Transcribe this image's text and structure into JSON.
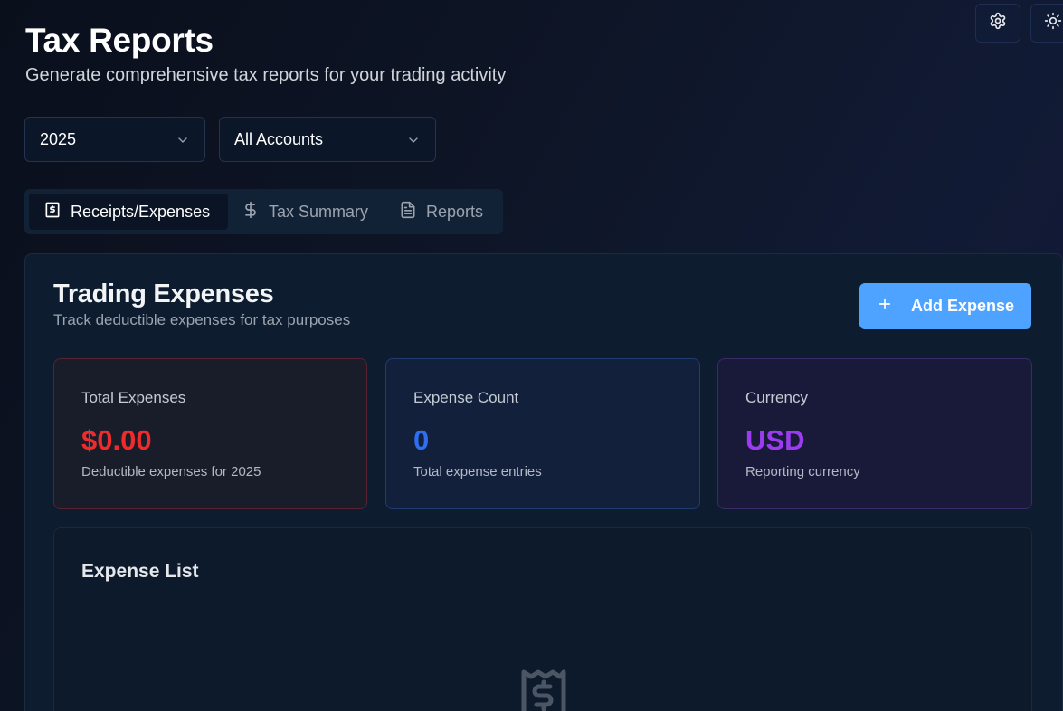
{
  "header": {
    "title": "Tax Reports",
    "subtitle": "Generate comprehensive tax reports for your trading activity"
  },
  "toolbar": {
    "settings_icon": "gear-icon",
    "theme_icon": "sun-icon"
  },
  "filters": {
    "year": "2025",
    "account": "All Accounts"
  },
  "tabs": [
    {
      "label": "Receipts/Expenses",
      "icon": "receipt-icon",
      "active": true
    },
    {
      "label": "Tax Summary",
      "icon": "dollar-icon",
      "active": false
    },
    {
      "label": "Reports",
      "icon": "file-text-icon",
      "active": false
    }
  ],
  "expenses": {
    "title": "Trading Expenses",
    "subtitle": "Track deductible expenses for tax purposes",
    "add_button_label": "Add Expense",
    "stats": [
      {
        "label": "Total Expenses",
        "value": "$0.00",
        "description": "Deductible expenses for 2025",
        "color": "#ef2b2b"
      },
      {
        "label": "Expense Count",
        "value": "0",
        "description": "Total expense entries",
        "color": "#2f6ef0"
      },
      {
        "label": "Currency",
        "value": "USD",
        "description": "Reporting currency",
        "color": "#9b3cf0"
      }
    ],
    "list": {
      "title": "Expense List",
      "empty_icon": "receipt-icon"
    }
  },
  "colors": {
    "accent": "#4da3ff",
    "background": "#0a0f1c",
    "card": "#0d1c2e"
  }
}
